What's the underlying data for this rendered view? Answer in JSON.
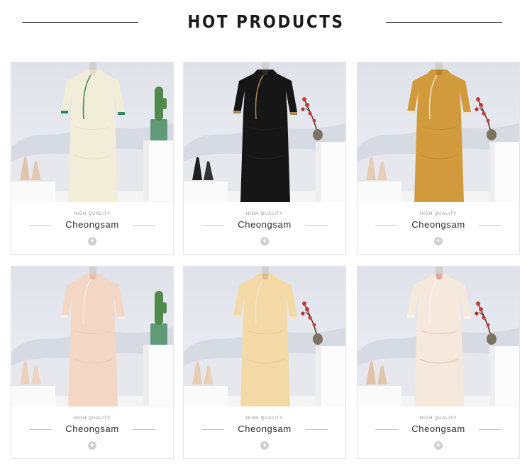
{
  "header": {
    "title": "HOT PRODUCTS"
  },
  "products": [
    {
      "quality": "HIGH QUALITY",
      "name": "Cheongsam",
      "plus": "+",
      "dress_color": "#f1edd8",
      "accent": "#e0dcc2",
      "trim": "#2e8a5a",
      "shoes": "#e2c4ac",
      "prop": "cactus"
    },
    {
      "quality": "HIGH QUALITY",
      "name": "Cheongsam",
      "plus": "+",
      "dress_color": "#161616",
      "accent": "#2a2a2a",
      "trim": "#b08a5a",
      "shoes": "#1e1e1e",
      "prop": "plum"
    },
    {
      "quality": "HIGH QUALITY",
      "name": "Cheongsam",
      "plus": "+",
      "dress_color": "#d19a3c",
      "accent": "#b98228",
      "trim": "#f2e6cf",
      "shoes": "#e6ccb2",
      "prop": "plum"
    },
    {
      "quality": "HIGH QUALITY",
      "name": "Cheongsam",
      "plus": "+",
      "dress_color": "#f4d6c4",
      "accent": "#e8bca6",
      "trim": "#f8ece4",
      "shoes": "#ecd0bc",
      "prop": "cactus"
    },
    {
      "quality": "HIGH QUALITY",
      "name": "Cheongsam",
      "plus": "+",
      "dress_color": "#f3d9a6",
      "accent": "#e9b98c",
      "trim": "#f3e3c4",
      "shoes": "#e8cdb0",
      "prop": "plum"
    },
    {
      "quality": "HIGH QUALITY",
      "name": "Cheongsam",
      "plus": "+",
      "dress_color": "#f5e8dc",
      "accent": "#e6a49a",
      "trim": "#f9f1ea",
      "shoes": "#e0c2a6",
      "prop": "plum"
    }
  ]
}
